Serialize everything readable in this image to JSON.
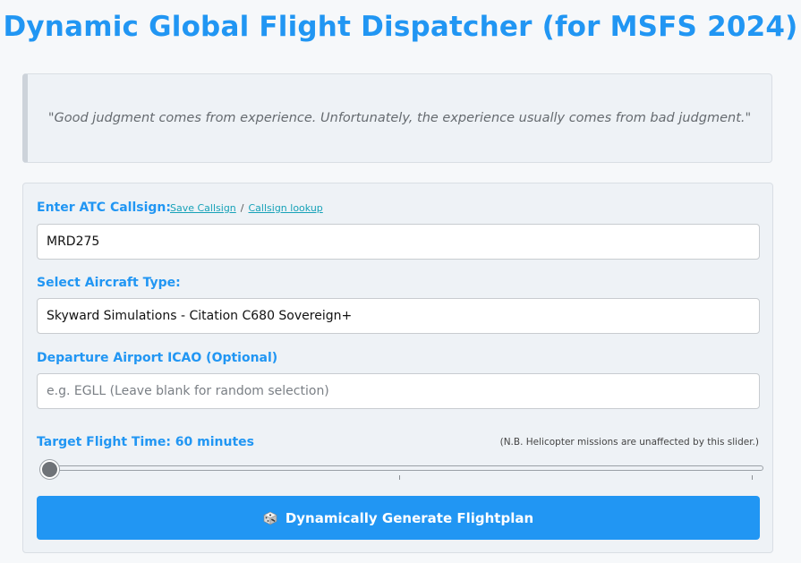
{
  "page": {
    "title": "Dynamic Global Flight Dispatcher (for MSFS 2024)"
  },
  "quote": {
    "text": "\"Good judgment comes from experience. Unfortunately, the experience usually comes from bad judgment.\""
  },
  "form": {
    "callsign": {
      "label": "Enter ATC Callsign:",
      "save_link": "Save Callsign",
      "separator": "/",
      "lookup_link": "Callsign lookup",
      "value": "MRD275"
    },
    "aircraft": {
      "label": "Select Aircraft Type:",
      "selected": "Skyward Simulations - Citation C680 Sovereign+"
    },
    "departure": {
      "label": "Departure Airport ICAO (Optional)",
      "value": "",
      "placeholder": "e.g. EGLL (Leave blank for random selection)"
    },
    "flight_time": {
      "label": "Target Flight Time: 60 minutes",
      "note": "(N.B. Helicopter missions are unaffected by this slider.)",
      "slider_fraction": 0.0
    },
    "generate_button": {
      "icon": "dice-icon",
      "label": "Dynamically Generate Flightplan"
    }
  },
  "colors": {
    "accent": "#2196f3",
    "link": "#17a2b8",
    "panel": "#eef2f6",
    "quote_text": "#666b70"
  }
}
